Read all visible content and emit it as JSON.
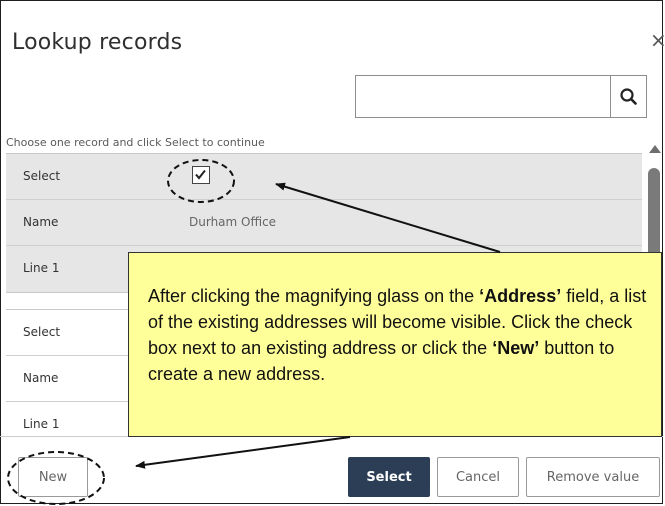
{
  "dialog": {
    "title": "Lookup records",
    "close_glyph": "×",
    "search": {
      "placeholder": "",
      "value": ""
    },
    "instruction": "Choose one record and click Select to continue"
  },
  "records": [
    {
      "select_label": "Select",
      "selected": true,
      "name_label": "Name",
      "name_value": "Durham Office",
      "line1_label": "Line 1",
      "line1_value": ""
    },
    {
      "select_label": "Select",
      "selected": false,
      "name_label": "Name",
      "name_value": "",
      "line1_label": "Line 1",
      "line1_value": ""
    }
  ],
  "footer": {
    "new_label": "New",
    "select_label": "Select",
    "cancel_label": "Cancel",
    "remove_label": "Remove value"
  },
  "callout": {
    "text_1": "After clicking the magnifying glass on the ",
    "bold_1": "‘Address’",
    "text_2": " field, a list of the existing addresses will become visible. Click the check box next to an existing address or click the ",
    "bold_2": "‘New’",
    "text_3": " button to create a new address."
  },
  "colors": {
    "primary_button": "#2c3e55",
    "callout_bg": "#ffff99",
    "selected_record_bg": "#e6e6e6"
  }
}
